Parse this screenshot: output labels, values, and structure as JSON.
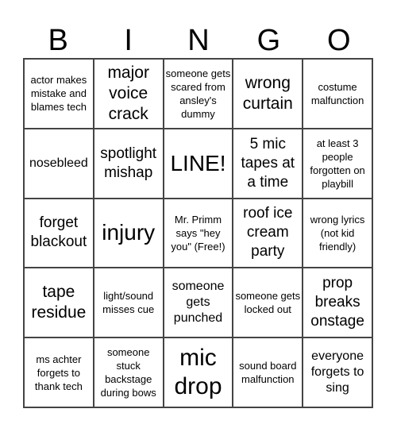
{
  "header": {
    "letters": [
      "B",
      "I",
      "N",
      "G",
      "O"
    ]
  },
  "cells": [
    "actor makes mistake and blames tech",
    "major voice crack",
    "someone gets scared from ansley's dummy",
    "wrong curtain",
    "costume malfunction",
    "nosebleed",
    "spotlight mishap",
    "LINE!",
    "5 mic tapes at a time",
    "at least 3 people forgotten on playbill",
    "forget blackout",
    "injury",
    "Mr. Primm says \"hey you\" (Free!)",
    "roof ice cream party",
    "wrong lyrics (not kid friendly)",
    "tape residue",
    "light/sound misses cue",
    "someone gets punched",
    "someone gets locked out",
    "prop breaks onstage",
    "ms achter forgets to thank tech",
    "someone stuck backstage during bows",
    "mic drop",
    "sound board malfunction",
    "everyone forgets to sing"
  ]
}
